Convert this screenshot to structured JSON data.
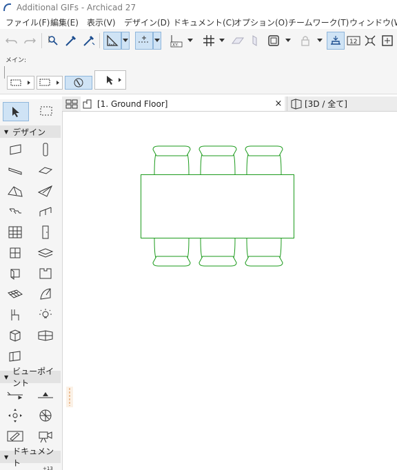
{
  "window": {
    "title": "Additional GIFs - Archicad 27"
  },
  "menu": [
    "ファイル(F)",
    "編集(E)",
    "表示(V)",
    "デザイン(D)",
    "ドキュメント(C)",
    "オプション(O)",
    "チームワーク(T)",
    "ウィンドウ(W)"
  ],
  "infobox": {
    "main_label": "メイン:"
  },
  "toolbox": {
    "sections": {
      "design": "デザイン",
      "viewpoint": "ビューポイント",
      "document": "ドキュメント"
    }
  },
  "tabs": {
    "floor": "[1. Ground Floor]",
    "close_glyph": "×",
    "three_d": "[3D / 全て]"
  },
  "colors": {
    "accent": "#cfe3f5",
    "accent_border": "#8fb6db",
    "plan_lines": "#1a9a1a"
  },
  "icons": [
    "undo-icon",
    "redo-icon",
    "find-select-icon",
    "pick-up-parameters-icon",
    "inject-parameters-icon",
    "guide-line-icon",
    "snap-guides-icon",
    "coordinate-input-icon",
    "grid-snap-icon",
    "surface-icon",
    "section-cut-icon",
    "view-cube-icon",
    "lock-icon",
    "trace-icon",
    "dimension-icon",
    "zoom-fit-icon",
    "layout-icon"
  ],
  "canvas": {
    "label_left": "",
    "description_visible": false
  }
}
